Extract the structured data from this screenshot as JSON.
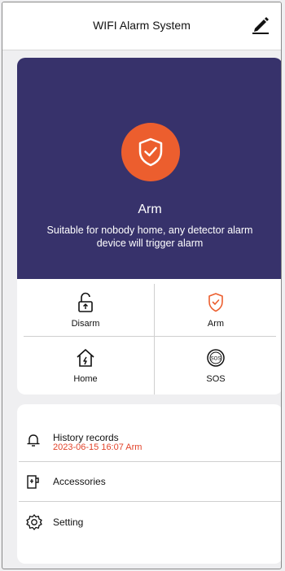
{
  "header": {
    "title": "WIFI Alarm System",
    "edit_icon": "pencil-icon"
  },
  "current_mode": {
    "label": "Arm",
    "description": "Suitable for nobody home, any detector alarm device will trigger alarm",
    "icon": "shield-check-icon",
    "color": "#ec5e2e"
  },
  "modes": [
    {
      "label": "Disarm",
      "icon": "unlock-icon",
      "active": false
    },
    {
      "label": "Arm",
      "icon": "shield-check-icon",
      "active": true
    },
    {
      "label": "Home",
      "icon": "home-shield-icon",
      "active": false
    },
    {
      "label": "SOS",
      "icon": "sos-icon",
      "active": false
    }
  ],
  "menu": {
    "history": {
      "label": "History records",
      "last_event": "2023-06-15  16:07 Arm",
      "icon": "bell-icon"
    },
    "accessories": {
      "label": "Accessories",
      "icon": "accessories-icon"
    },
    "setting": {
      "label": "Setting",
      "icon": "gear-icon"
    }
  },
  "colors": {
    "hero_bg": "#37326b",
    "accent": "#ec5e2e",
    "history_date": "#e2432a"
  }
}
